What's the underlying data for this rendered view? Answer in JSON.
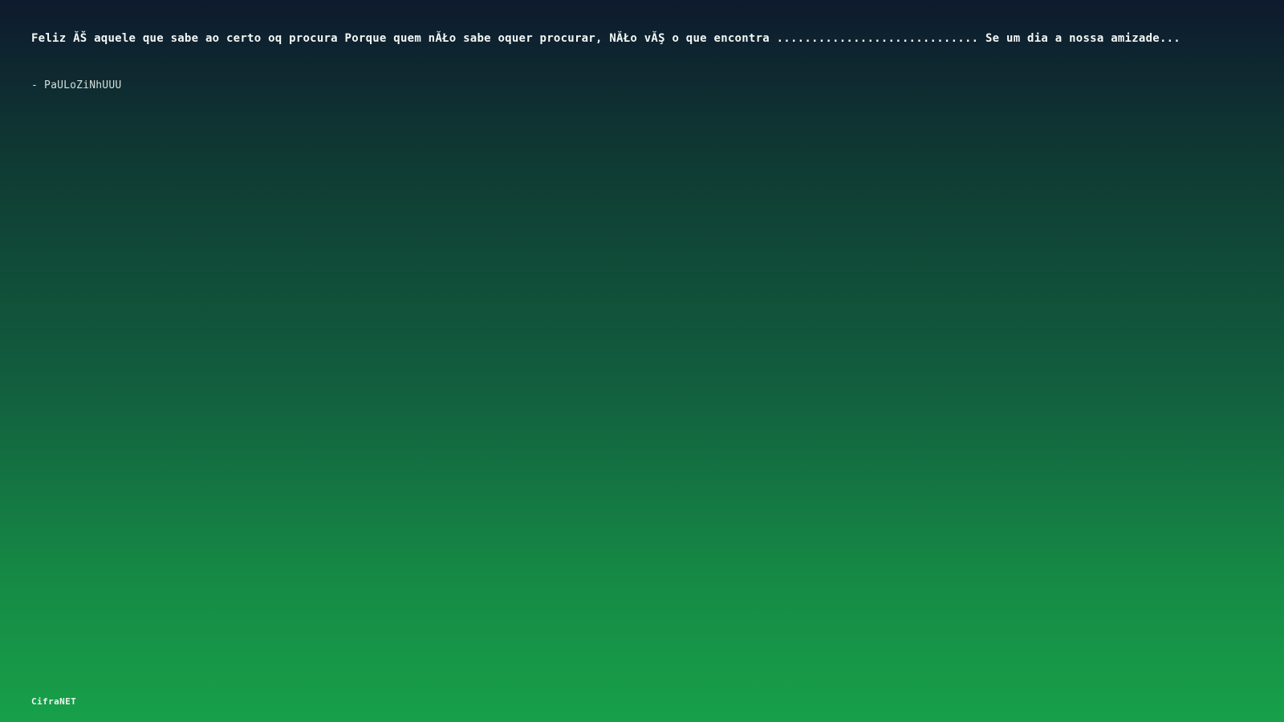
{
  "quote": {
    "text": "Feliz ĂŠ aquele que sabe ao certo oq procura Porque quem nĂŁo sabe oquer procurar, NĂŁo vĂŞ o que encontra ............................. Se um dia a nossa amizade..."
  },
  "author": {
    "text": "- PaULoZiNhUUU"
  },
  "footer": {
    "brand": "CifraNET"
  },
  "colors": {
    "gradient_top": "#0e1a2e",
    "gradient_bottom": "#17a049",
    "text": "#ffffff"
  }
}
